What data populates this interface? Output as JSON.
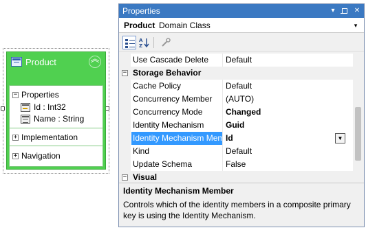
{
  "entity": {
    "title": "Product",
    "collapse_glyph": "︽",
    "compartments": {
      "properties": {
        "label": "Properties",
        "expander": "−"
      },
      "implementation": {
        "label": "Implementation",
        "expander": "+"
      },
      "navigation": {
        "label": "Navigation",
        "expander": "+"
      }
    },
    "properties": [
      {
        "text": "Id : Int32",
        "icon": "key-property-icon"
      },
      {
        "text": "Name : String",
        "icon": "property-icon"
      }
    ]
  },
  "properties_window": {
    "title": "Properties",
    "title_buttons": {
      "dropdown": "▾",
      "pin": "",
      "close": "✕"
    },
    "selected_object": {
      "name": "Product",
      "type": "Domain Class",
      "dropdown": "▾"
    },
    "toolbar": {
      "categorized_icon": "categorized-icon",
      "alphabetical_icon": "alphabetical-icon",
      "property_pages_icon": "wrench-icon"
    },
    "rows": [
      {
        "kind": "prop",
        "name": "Use Cascade Delete",
        "value": "Default",
        "bold": false
      },
      {
        "kind": "cat",
        "name": "Storage Behavior",
        "expander": "−"
      },
      {
        "kind": "prop",
        "name": "Cache Policy",
        "value": "Default",
        "bold": false
      },
      {
        "kind": "prop",
        "name": "Concurrency Member",
        "value": "(AUTO)",
        "bold": false
      },
      {
        "kind": "prop",
        "name": "Concurrency Mode",
        "value": "Changed",
        "bold": true
      },
      {
        "kind": "prop",
        "name": "Identity Mechanism",
        "value": "Guid",
        "bold": true
      },
      {
        "kind": "prop",
        "name": "Identity Mechanism Member",
        "value": "Id",
        "bold": true,
        "selected": true,
        "dropdown": "▼"
      },
      {
        "kind": "prop",
        "name": "Kind",
        "value": "Default",
        "bold": false
      },
      {
        "kind": "prop",
        "name": "Update Schema",
        "value": "False",
        "bold": false
      },
      {
        "kind": "cat",
        "name": "Visual",
        "expander": "−"
      }
    ],
    "description": {
      "title": "Identity Mechanism Member",
      "text": "Controls which of the identity members in a composite primary key is using the Identity Mechanism."
    }
  },
  "colors": {
    "entity_fill": "#50d050",
    "title_bar": "#3b79c2",
    "selection": "#3399ff"
  }
}
